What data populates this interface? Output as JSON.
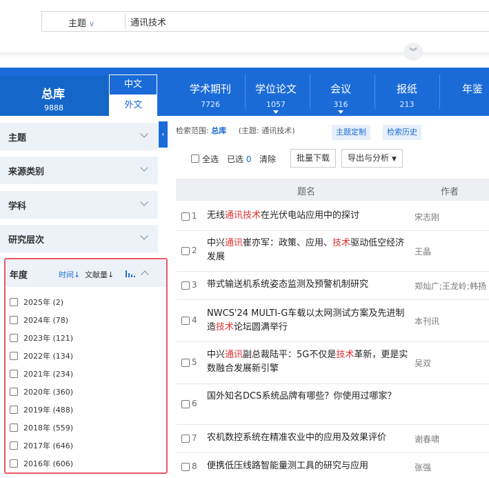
{
  "search": {
    "field": "主题",
    "query": "通讯技术"
  },
  "banner": {
    "main_tab": {
      "name": "总库",
      "count": "9888"
    },
    "lang_zh": "中文",
    "lang_en": "外文",
    "categories": [
      {
        "name": "学术期刊",
        "count": "7726"
      },
      {
        "name": "学位论文",
        "count": "1057"
      },
      {
        "name": "会议",
        "count": "316"
      },
      {
        "name": "报纸",
        "count": "213"
      },
      {
        "name": "年鉴",
        "count": ""
      }
    ]
  },
  "sidebar": {
    "facets": [
      "主题",
      "来源类别",
      "学科",
      "研究层次"
    ],
    "year_panel": {
      "title": "年度",
      "sort_time": "时间↓",
      "sort_ref": "文献量↓",
      "years": [
        "2025年 (2)",
        "2024年 (78)",
        "2023年 (121)",
        "2022年 (134)",
        "2021年 (234)",
        "2020年 (360)",
        "2019年 (488)",
        "2018年 (559)",
        "2017年 (646)",
        "2016年 (606)"
      ]
    }
  },
  "scope": {
    "label": "检索范围:",
    "value": "总库",
    "topic": "(主题: 通讯技术)",
    "topic_custom": "主题定制",
    "history": "检索历史"
  },
  "toolbar": {
    "select_all": "全选",
    "selected_label": "已选",
    "selected_count": "0",
    "clear": "清除",
    "batch_download": "批量下载",
    "export": "导出与分析"
  },
  "table": {
    "header_title": "题名",
    "header_author": "作者",
    "rows": [
      {
        "num": "1",
        "pre": "无线",
        "hl1": "通讯技术",
        "mid": "在光伏电站应用中的探讨",
        "hl2": "",
        "post": "",
        "author": "宋志刚"
      },
      {
        "num": "2",
        "pre": "中兴",
        "hl1": "通讯",
        "mid": "崔亦军：政策、应用、",
        "hl2": "技术",
        "post": "驱动低空经济发展",
        "author": "王晶"
      },
      {
        "num": "3",
        "pre": "带式输送机系统姿态监测及预警机制研究",
        "hl1": "",
        "mid": "",
        "hl2": "",
        "post": "",
        "author": "郑灿广;王龙岭;韩扬"
      },
      {
        "num": "4",
        "pre": "NWCS'24 MULTI-G车载以太网测试方案及先进制造",
        "hl1": "技术",
        "mid": "论坛圆满举行",
        "hl2": "",
        "post": "",
        "author": "本刊讯"
      },
      {
        "num": "5",
        "pre": "中兴",
        "hl1": "通讯",
        "mid": "副总裁陆平：5G不仅是",
        "hl2": "技术",
        "post": "革新，更是实数融合发展新引擎",
        "author": "吴双"
      },
      {
        "num": "6",
        "pre": "国外知名DCS系统品牌有哪些？你使用过哪家？",
        "hl1": "",
        "mid": "",
        "hl2": "",
        "post": "",
        "author": ""
      },
      {
        "num": "7",
        "pre": "农机数控系统在精准农业中的应用及效果评价",
        "hl1": "",
        "mid": "",
        "hl2": "",
        "post": "",
        "author": "谢春啸"
      },
      {
        "num": "8",
        "pre": "便携低压线路智能量测工具的研究与应用",
        "hl1": "",
        "mid": "",
        "hl2": "",
        "post": "",
        "author": "张强"
      }
    ]
  },
  "colors": {
    "brand": "#1a6bd8",
    "highlight": "#e03030",
    "panel_border": "#ea5866"
  }
}
